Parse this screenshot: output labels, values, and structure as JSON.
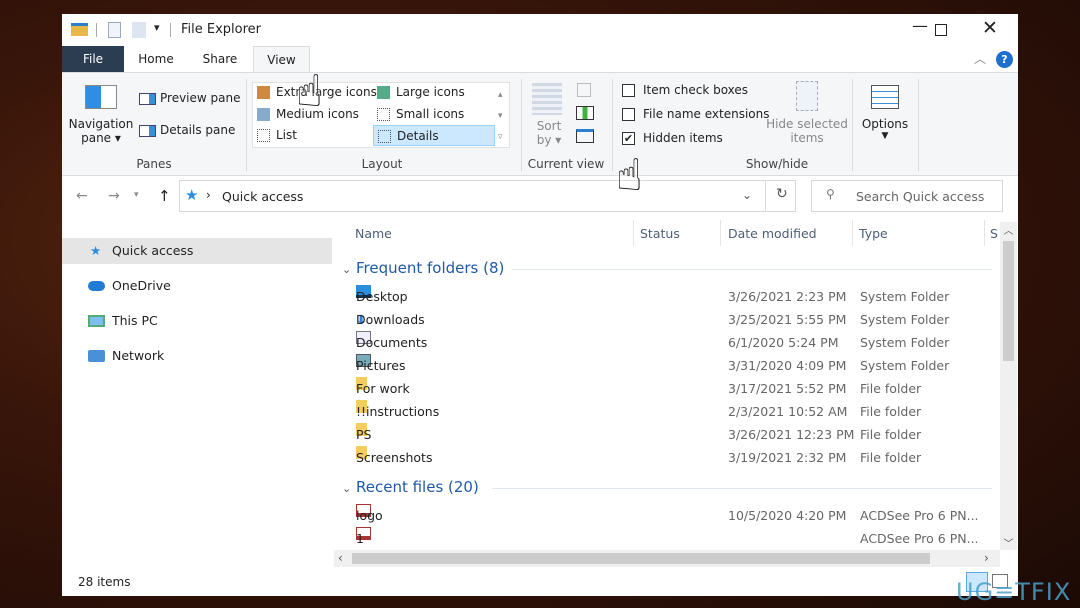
{
  "window": {
    "title": "File Explorer"
  },
  "tabs": [
    {
      "label": "File"
    },
    {
      "label": "Home"
    },
    {
      "label": "Share"
    },
    {
      "label": "View"
    }
  ],
  "ribbon": {
    "panes": {
      "navigation": "Navigation",
      "navigation2": "pane",
      "preview": "Preview pane",
      "details": "Details pane",
      "label": "Panes"
    },
    "layout": {
      "items": [
        "Extra large icons",
        "Large icons",
        "Medium icons",
        "Small icons",
        "List",
        "Details"
      ],
      "selected": "Details",
      "label": "Layout"
    },
    "current_view": {
      "sort": "Sort",
      "sort2": "by",
      "label": "Current view"
    },
    "show_hide": {
      "item_check_boxes": "Item check boxes",
      "item_check_boxes_checked": false,
      "file_name_extensions": "File name extensions",
      "file_name_extensions_checked": false,
      "hidden_items": "Hidden items",
      "hidden_items_checked": true,
      "hide_selected": "Hide selected",
      "hide_selected2": "items",
      "label": "Show/hide"
    },
    "options": "Options"
  },
  "address": {
    "path": "Quick access",
    "search_placeholder": "Search Quick access"
  },
  "nav": [
    {
      "label": "Quick access",
      "icon": "star-icon",
      "selected": true
    },
    {
      "label": "OneDrive",
      "icon": "cloud-icon"
    },
    {
      "label": "This PC",
      "icon": "monitor-icon"
    },
    {
      "label": "Network",
      "icon": "network-icon"
    }
  ],
  "columns": [
    "Name",
    "Status",
    "Date modified",
    "Type",
    "S"
  ],
  "groups": {
    "frequent": {
      "label": "Frequent folders (8)",
      "items": [
        {
          "name": "Desktop",
          "date": "3/26/2021 2:23 PM",
          "type": "System Folder",
          "icon": "desktop-icon"
        },
        {
          "name": "Downloads",
          "date": "3/25/2021 5:55 PM",
          "type": "System Folder",
          "icon": "download-icon"
        },
        {
          "name": "Documents",
          "date": "6/1/2020 5:24 PM",
          "type": "System Folder",
          "icon": "document-icon"
        },
        {
          "name": "Pictures",
          "date": "3/31/2020 4:09 PM",
          "type": "System Folder",
          "icon": "pictures-icon"
        },
        {
          "name": "For work",
          "date": "3/17/2021 5:52 PM",
          "type": "File folder",
          "icon": "folder-icon"
        },
        {
          "name": "!!instructions",
          "date": "2/3/2021 10:52 AM",
          "type": "File folder",
          "icon": "folder-icon"
        },
        {
          "name": "PS",
          "date": "3/26/2021 12:23 PM",
          "type": "File folder",
          "icon": "folder-icon"
        },
        {
          "name": "Screenshots",
          "date": "3/19/2021 2:32 PM",
          "type": "File folder",
          "icon": "folder-icon"
        }
      ]
    },
    "recent": {
      "label": "Recent files (20)",
      "items": [
        {
          "name": "logo",
          "date": "10/5/2020 4:20 PM",
          "type": "ACDSee Pro 6 PN...",
          "icon": "png-file-icon"
        },
        {
          "name": "1",
          "date": "",
          "type": "ACDSee Pro 6 PN...",
          "icon": "png-file-icon"
        }
      ]
    }
  },
  "status": {
    "count": "28 items"
  },
  "watermark": "UG≡TFIX",
  "colors": {
    "accent": "#1e5aa8",
    "file_tab": "#2b3d50",
    "selected": "#cce8ff"
  }
}
